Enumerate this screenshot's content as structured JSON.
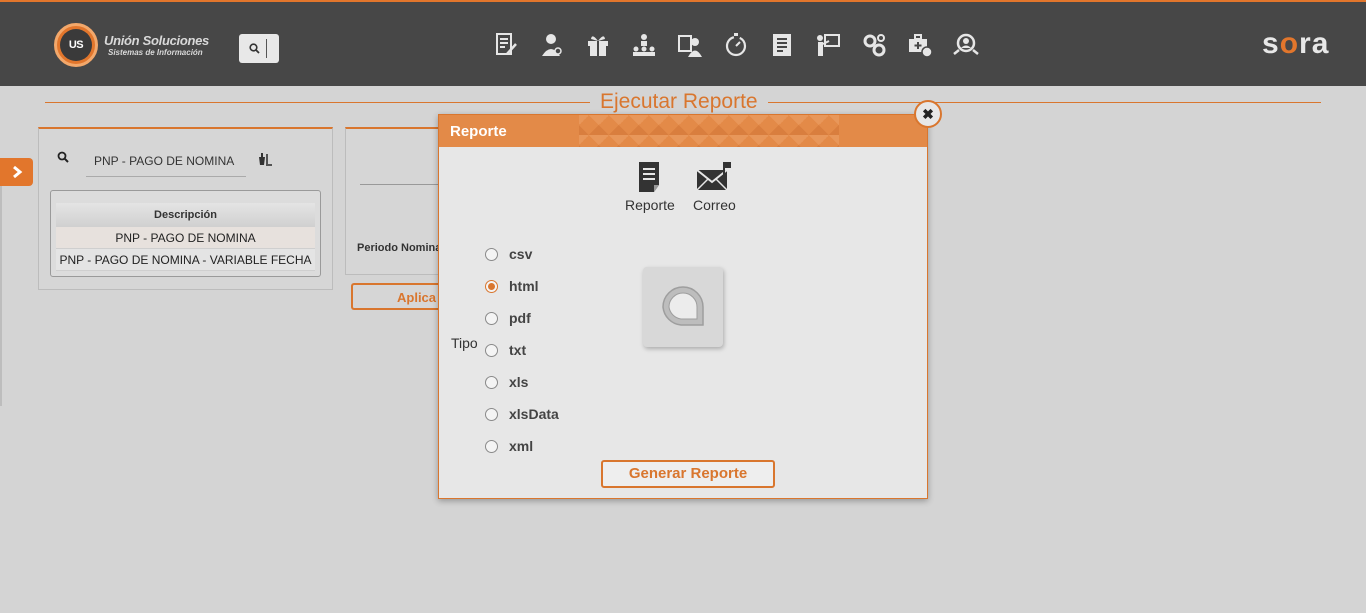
{
  "header": {
    "logo_badge": "US",
    "logo_title": "Unión Soluciones",
    "logo_subtitle": "Sistemas de Información",
    "brand": {
      "pre": "s",
      "accent": "o",
      "post": "ra"
    },
    "nav_icons": [
      "document-edit-icon",
      "user-icon",
      "gift-icon",
      "org-chart-icon",
      "user-card-icon",
      "stopwatch-icon",
      "report-list-icon",
      "training-icon",
      "gears-icon",
      "medical-kit-icon",
      "user-search-icon"
    ]
  },
  "page": {
    "title": "Ejecutar Reporte"
  },
  "left_panel": {
    "search_value": "PNP - PAGO DE NOMINA",
    "table_header": "Descripción",
    "rows": [
      "PNP - PAGO DE NOMINA",
      "PNP - PAGO DE NOMINA - VARIABLE FECHA"
    ]
  },
  "mid_panel": {
    "label": "Periodo Nomina",
    "apply_label": "Aplica"
  },
  "modal": {
    "title": "Reporte",
    "option_report": "Reporte",
    "option_mail": "Correo",
    "tipo_label": "Tipo",
    "formats": [
      "csv",
      "html",
      "pdf",
      "txt",
      "xls",
      "xlsData",
      "xml"
    ],
    "selected_format": "html",
    "generate_label": "Generar Reporte",
    "close_symbol": "✖"
  },
  "colors": {
    "accent": "#d9762e",
    "topbar": "#474747",
    "background": "#d4d4d4"
  }
}
